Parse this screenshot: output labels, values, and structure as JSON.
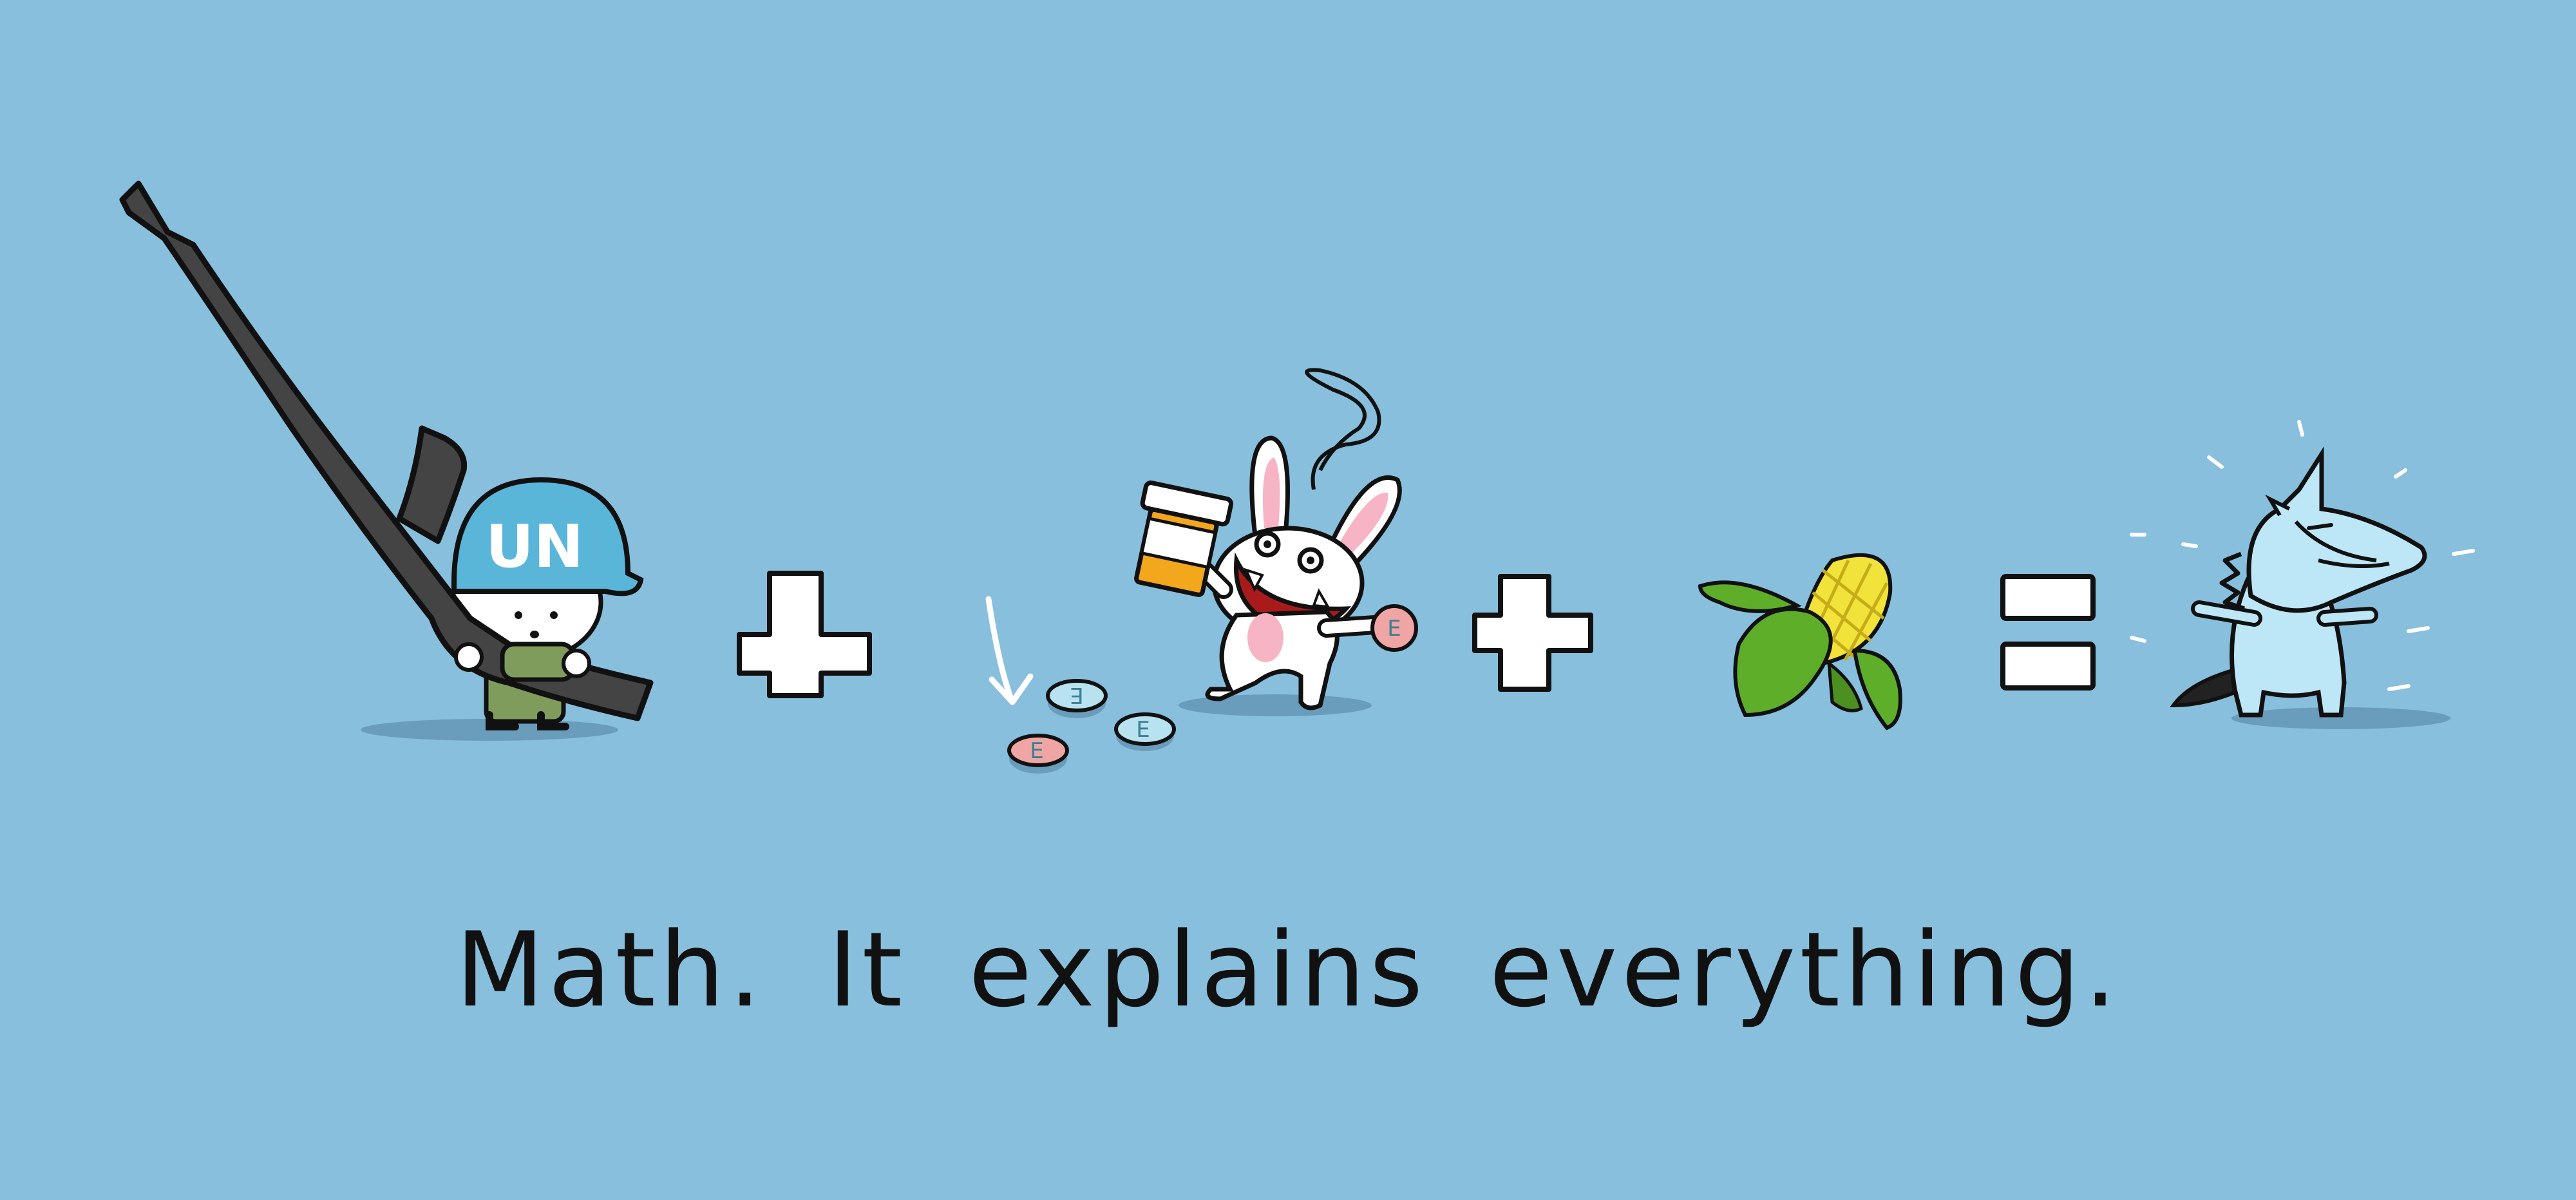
{
  "caption": "Math. It explains everything.",
  "helmet_text": "UN",
  "pill_letter": "E",
  "colors": {
    "background": "#88bfdd",
    "ink": "#111111",
    "helmet": "#5ab6d8",
    "rifle": "#444444",
    "uniform": "#7f9c5d",
    "bottle": "#f2a71c",
    "pill_pink": "#f0a5a5",
    "pill_blue": "#b8e2f0",
    "rabbit_mouth": "#a91b1b",
    "corn_kernels": "#f2e33a",
    "corn_husk": "#5fae2a",
    "unicorn": "#bde6f6",
    "shadow": "#6a9cbc"
  },
  "operators": [
    "plus",
    "plus",
    "equals"
  ]
}
